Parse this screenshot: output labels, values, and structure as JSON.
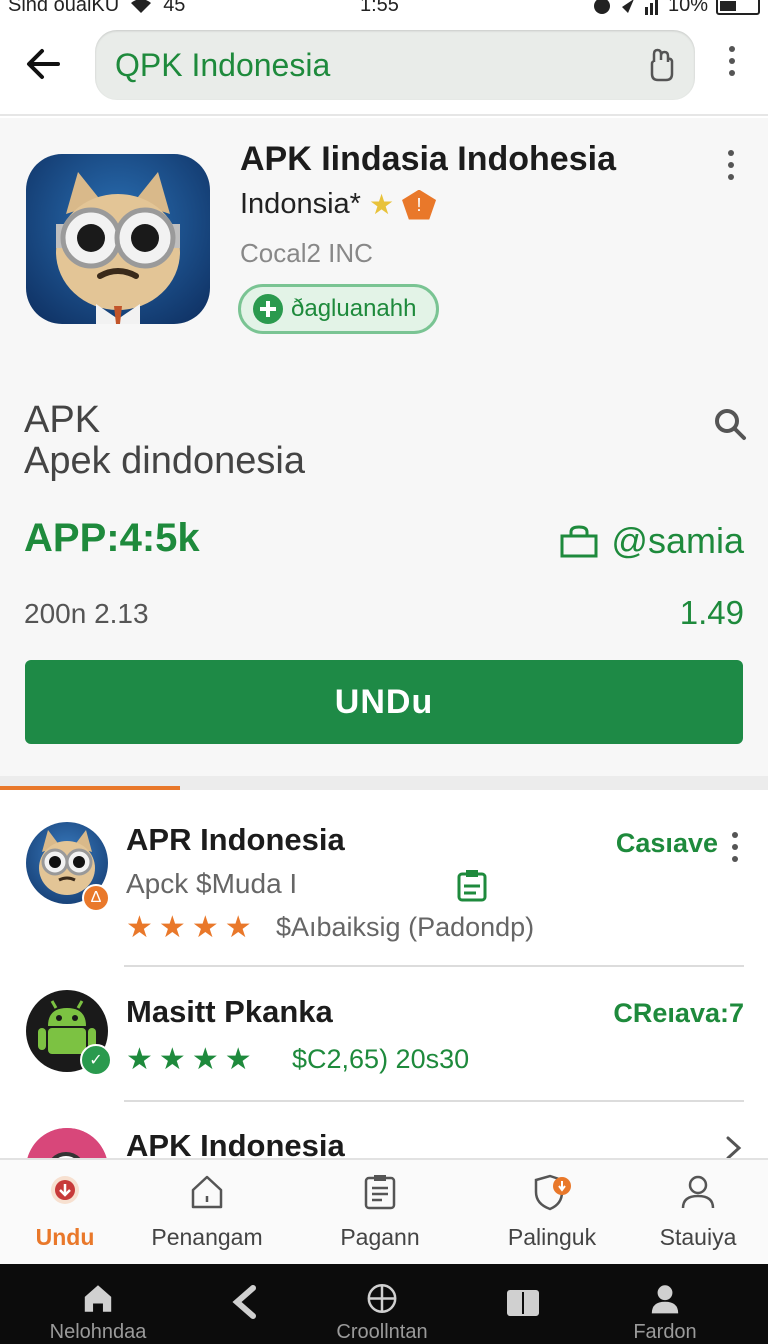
{
  "status_bar": {
    "carrier": "Sind oualKU",
    "signal": "45",
    "time": "1:55",
    "battery": "10%"
  },
  "search": {
    "query": "QPK Indonesia"
  },
  "app": {
    "title": "APK Iindasia Indohesia",
    "subtitle": "Indonsia*",
    "developer": "Cocal2 INC",
    "verified_label": "ðagluanahh",
    "apk_label": "APK",
    "apk_name": "Apek dindonesia",
    "stat_app": "APP:4:5k",
    "stat_right": "@samia",
    "meta_left": "200n 2.13",
    "meta_right": "1.49",
    "download_label": "UNDu"
  },
  "list": [
    {
      "title": "APR Indonesia",
      "subtitle": "Apck $Muda I",
      "stars": 4,
      "meta": "$Aıbaiksig (Padondp)",
      "action": "Casıave"
    },
    {
      "title": "Masitt Pkanka",
      "stars": 4,
      "meta": "$C2,65) 20s30",
      "action": "CReıava:7"
    },
    {
      "title": "APK Indonesia"
    }
  ],
  "bottom_nav": [
    {
      "label": "Undu",
      "icon": "download-icon",
      "active": true
    },
    {
      "label": "Penangam",
      "icon": "home-icon",
      "active": false
    },
    {
      "label": "Pagann",
      "icon": "clipboard-icon",
      "active": false
    },
    {
      "label": "Palinguk",
      "icon": "shield-badge-icon",
      "active": false
    },
    {
      "label": "Stauiya",
      "icon": "person-icon",
      "active": false
    }
  ],
  "system_nav": [
    {
      "label": "Nelohndaa",
      "icon": "home-icon"
    },
    {
      "label": "",
      "icon": "back-icon"
    },
    {
      "label": "Croollntan",
      "icon": "crosshair-icon"
    },
    {
      "label": "",
      "icon": "book-icon"
    },
    {
      "label": "Fardon",
      "icon": "person-icon"
    }
  ],
  "colors": {
    "accent_green": "#1e8a46",
    "text_green": "#1e8a3c",
    "accent_orange": "#e9782a",
    "star_orange": "#e9782a",
    "star_green": "#1e8a3c"
  }
}
